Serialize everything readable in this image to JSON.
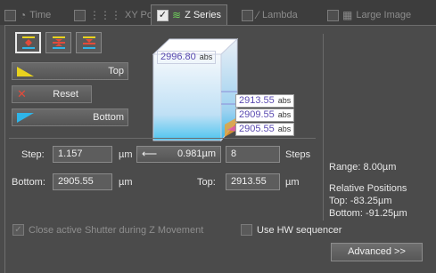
{
  "tabs": [
    {
      "label": "Time",
      "icon": "clock-icon",
      "checked": false
    },
    {
      "label": "XY Pos",
      "icon": "grid-icon",
      "checked": false
    },
    {
      "label": "Z Series",
      "icon": "z-stack-icon",
      "checked": true
    },
    {
      "label": "Lambda",
      "icon": "lambda-icon",
      "checked": false
    },
    {
      "label": "Large Image",
      "icon": "large-image-icon",
      "checked": false
    }
  ],
  "buttons": {
    "top": "Top",
    "reset": "Reset",
    "bottom": "Bottom",
    "advanced": "Advanced >>"
  },
  "cube": {
    "top_value": "2996.80",
    "top_unit": "abs",
    "positions": [
      {
        "value": "2913.55",
        "unit": "abs"
      },
      {
        "value": "2909.55",
        "unit": "abs"
      },
      {
        "value": "2905.55",
        "unit": "abs"
      }
    ]
  },
  "step": {
    "label": "Step:",
    "value": "1.157",
    "unit": "µm",
    "arrow_value": "0.981µm",
    "steps_value": "8",
    "steps_label": "Steps"
  },
  "range": {
    "bottom_label": "Bottom:",
    "bottom_value": "2905.55",
    "bottom_unit": "µm",
    "top_label": "Top:",
    "top_value": "2913.55",
    "top_unit": "µm"
  },
  "info": {
    "range": "Range: 8.00µm",
    "relative_heading": "Relative Positions",
    "relative_top": "Top: -83.25µm",
    "relative_bottom": "Bottom: -91.25µm"
  },
  "options": {
    "close_shutter": "Close active Shutter during Z Movement",
    "use_hw_sequencer": "Use HW sequencer"
  },
  "colors": {
    "accent_green": "#6fd15b",
    "yellow": "#e8d21e",
    "cyan": "#2fb5e8",
    "red": "#e24b3b",
    "value_text": "#5b4bb1"
  }
}
